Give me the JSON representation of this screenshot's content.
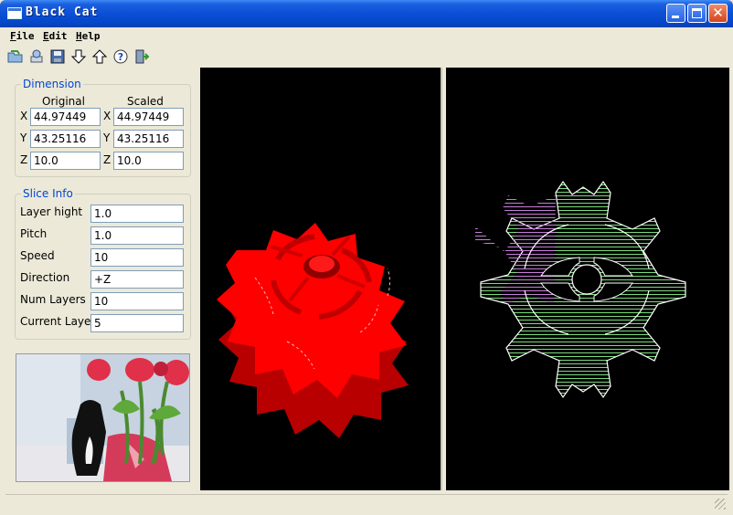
{
  "window": {
    "title": "Black Cat"
  },
  "menu": {
    "file": "File",
    "edit": "Edit",
    "help": "Help"
  },
  "toolbar": {
    "icons": [
      "open-icon",
      "scan-icon",
      "save-icon",
      "arrow-down-icon",
      "arrow-up-icon",
      "help-icon",
      "exit-icon"
    ]
  },
  "dimension": {
    "title": "Dimension",
    "original_label": "Original",
    "scaled_label": "Scaled",
    "x_label": "X",
    "y_label": "Y",
    "z_label": "Z",
    "original": {
      "x": "44.97449",
      "y": "43.25116",
      "z": "10.0"
    },
    "scaled": {
      "x": "44.97449",
      "y": "43.25116",
      "z": "10.0"
    }
  },
  "slice_info": {
    "title": "Slice Info",
    "layer_hight_label": "Layer hight",
    "layer_hight": "1.0",
    "pitch_label": "Pitch",
    "pitch": "1.0",
    "speed_label": "Speed",
    "speed": "10",
    "direction_label": "Direction",
    "direction": "+Z",
    "num_layers_label": "Num Layers",
    "num_layers": "10",
    "current_layer_label": "Current Layer",
    "current_layer": "5"
  },
  "colors": {
    "model": "#ff0000",
    "slice_outline": "#ffffff",
    "hatch_green": "#7ddb7d",
    "hatch_purple": "#c77dd9",
    "hatch_blue": "#7d8bdb"
  }
}
